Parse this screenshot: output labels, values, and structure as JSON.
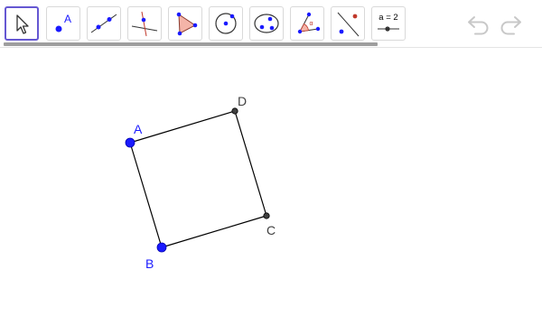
{
  "toolbar": {
    "tools": [
      {
        "name": "move-tool",
        "selected": true
      },
      {
        "name": "point-tool",
        "icon_text": "A"
      },
      {
        "name": "line-tool"
      },
      {
        "name": "perpendicular-line-tool"
      },
      {
        "name": "polygon-tool"
      },
      {
        "name": "circle-with-center-tool"
      },
      {
        "name": "conic-tool"
      },
      {
        "name": "angle-tool",
        "icon_text": "α"
      },
      {
        "name": "reflect-about-line-tool"
      },
      {
        "name": "slider-tool",
        "icon_text": "a = 2"
      }
    ],
    "undo": "undo-icon",
    "redo": "redo-icon"
  },
  "graphics": {
    "points": [
      {
        "label": "A",
        "color": "#1a1aff"
      },
      {
        "label": "B",
        "color": "#1a1aff"
      },
      {
        "label": "C",
        "color": "#404040"
      },
      {
        "label": "D",
        "color": "#404040"
      }
    ],
    "segment_color": "#000000"
  },
  "colors": {
    "accent": "#6557d2",
    "free_point": "#1a1aff",
    "dependent_point": "#404040",
    "polygon_fill": "#f4b4a8"
  }
}
